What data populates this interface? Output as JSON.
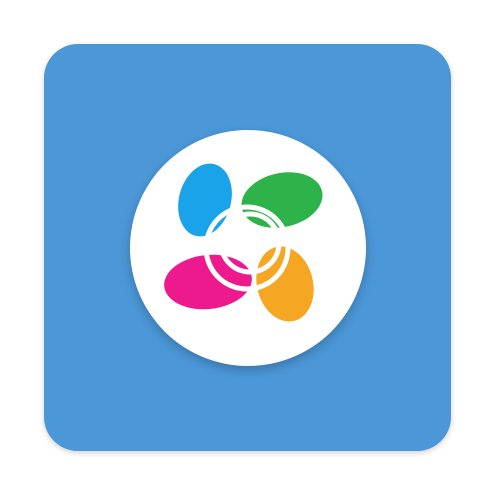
{
  "app_icon": {
    "icon_name": "ezviz-app-icon",
    "colors": {
      "tile": "#4b97d8",
      "badge": "#ffffff",
      "petal_blue": "#1aa3e8",
      "petal_green": "#2db34a",
      "petal_pink": "#ec1a8c",
      "petal_orange": "#f5a623",
      "rings": "#ffffff"
    }
  }
}
